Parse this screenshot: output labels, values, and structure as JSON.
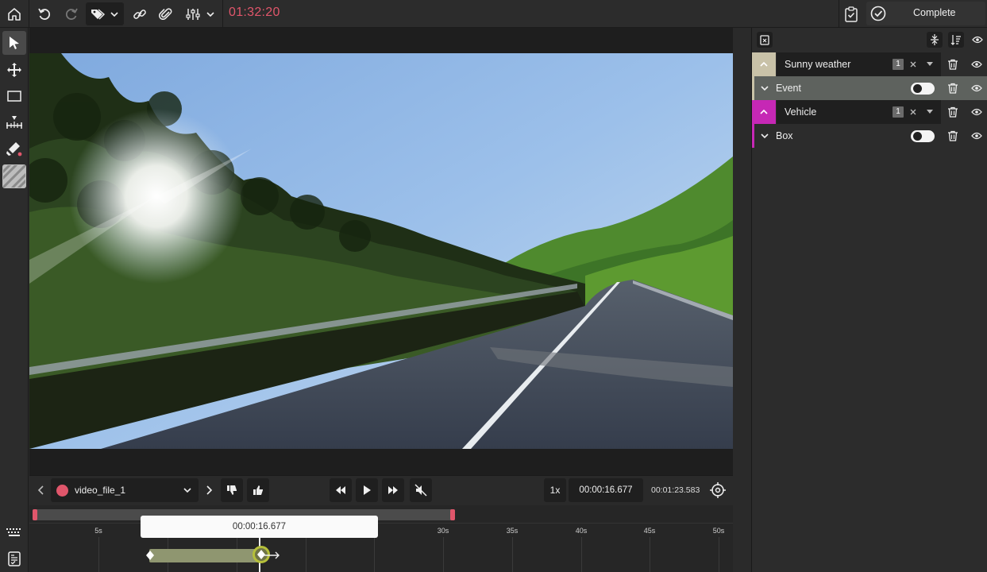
{
  "topbar": {
    "timer": "01:32:20",
    "complete_label": "Complete",
    "icons": [
      "home-icon",
      "undo-icon",
      "redo-icon",
      "tag-icon",
      "chevron-down-icon",
      "link-icon",
      "paperclip-icon",
      "sliders-icon",
      "chevron-down-icon",
      "clipboard-check-icon",
      "check-circle-icon"
    ]
  },
  "left_tools": [
    "cursor-icon",
    "move-icon",
    "rectangle-icon",
    "ruler-icon",
    "paint-icon",
    "hatch-icon",
    "keyboard-icon",
    "report-icon"
  ],
  "player": {
    "file_name": "video_file_1",
    "speed": "1x",
    "current_time": "00:00:16.677",
    "total_time": "00:01:23.583"
  },
  "timeline": {
    "tooltip_time": "00:00:16.677",
    "ticks": [
      "5s",
      "30s",
      "35s",
      "40s",
      "45s",
      "50s"
    ]
  },
  "right_panel": {
    "rows": [
      {
        "label": "Sunny weather",
        "count": "1",
        "color": "#c9c2a8"
      },
      {
        "label": "Event",
        "toggle": "off"
      },
      {
        "label": "Vehicle",
        "count": "1",
        "color": "#c628b5"
      },
      {
        "label": "Box",
        "toggle": "off"
      }
    ]
  },
  "colors": {
    "accent_red": "#e0566b",
    "segment_green": "#8f9670",
    "vehicle_magenta": "#c628b5"
  }
}
